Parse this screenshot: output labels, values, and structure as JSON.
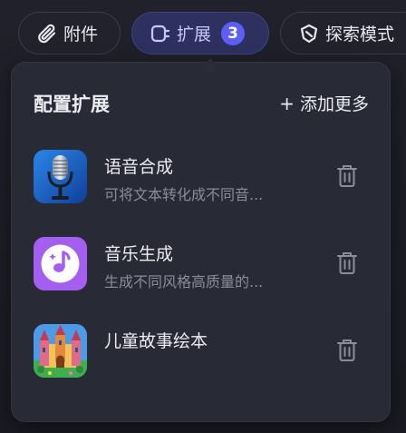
{
  "toolbar": {
    "attach_label": "附件",
    "extensions_label": "扩展",
    "extensions_count": "3",
    "explore_label": "探索模式"
  },
  "panel": {
    "title": "配置扩展",
    "add_more_plus": "+",
    "add_more_label": "添加更多",
    "items": [
      {
        "name": "语音合成",
        "desc": "可将文本转化成不同音...",
        "icon": "microphone-icon"
      },
      {
        "name": "音乐生成",
        "desc": "生成不同风格高质量的...",
        "icon": "music-note-icon"
      },
      {
        "name": "儿童故事绘本",
        "desc": "",
        "icon": "castle-icon"
      }
    ]
  },
  "colors": {
    "accent": "#5b5ff5",
    "panel_bg": "#282a35",
    "music_purple": "#a55ff0",
    "mic_blue": "#1f6fd3"
  }
}
